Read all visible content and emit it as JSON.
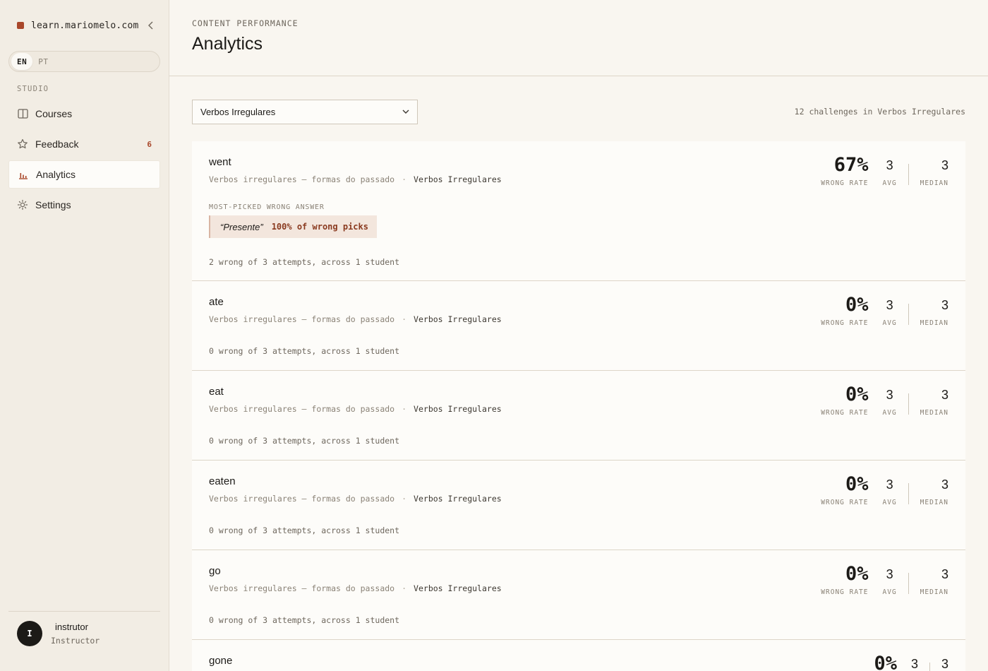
{
  "sidebar": {
    "brand": "learn.mariomelo.com",
    "languages": [
      "EN",
      "PT"
    ],
    "section_label": "STUDIO",
    "nav": [
      {
        "label": "Courses",
        "icon": "book-icon",
        "badge": ""
      },
      {
        "label": "Feedback",
        "icon": "star-icon",
        "badge": "6"
      },
      {
        "label": "Analytics",
        "icon": "bar-chart-icon",
        "badge": ""
      },
      {
        "label": "Settings",
        "icon": "gear-icon",
        "badge": ""
      }
    ],
    "user": {
      "initial": "I",
      "name": "instrutor",
      "role": "Instructor"
    }
  },
  "header": {
    "eyebrow": "CONTENT PERFORMANCE",
    "title": "Analytics"
  },
  "filter": {
    "selected": "Verbos Irregulares",
    "count_text": "12 challenges in Verbos Irregulares"
  },
  "stat_labels": {
    "wrong_rate": "WRONG RATE",
    "avg": "AVG",
    "median": "MEDIAN"
  },
  "challenges": [
    {
      "word": "went",
      "lesson": "Verbos irregulares — formas do passado",
      "separator": "·",
      "course": "Verbos Irregulares",
      "wrong_rate": "67%",
      "avg": "3",
      "median": "3",
      "most_picked_label": "MOST-PICKED WRONG ANSWER",
      "most_picked_answer": "“Presente”",
      "most_picked_pct": "100% of wrong picks",
      "summary": "2 wrong of 3 attempts, across 1 student"
    },
    {
      "word": "ate",
      "lesson": "Verbos irregulares — formas do passado",
      "separator": "·",
      "course": "Verbos Irregulares",
      "wrong_rate": "0%",
      "avg": "3",
      "median": "3",
      "summary": "0 wrong of 3 attempts, across 1 student"
    },
    {
      "word": "eat",
      "lesson": "Verbos irregulares — formas do passado",
      "separator": "·",
      "course": "Verbos Irregulares",
      "wrong_rate": "0%",
      "avg": "3",
      "median": "3",
      "summary": "0 wrong of 3 attempts, across 1 student"
    },
    {
      "word": "eaten",
      "lesson": "Verbos irregulares — formas do passado",
      "separator": "·",
      "course": "Verbos Irregulares",
      "wrong_rate": "0%",
      "avg": "3",
      "median": "3",
      "summary": "0 wrong of 3 attempts, across 1 student"
    },
    {
      "word": "go",
      "lesson": "Verbos irregulares — formas do passado",
      "separator": "·",
      "course": "Verbos Irregulares",
      "wrong_rate": "0%",
      "avg": "3",
      "median": "3",
      "summary": "0 wrong of 3 attempts, across 1 student"
    },
    {
      "word": "gone",
      "lesson": "",
      "separator": "",
      "course": "",
      "wrong_rate": "0%",
      "avg": "3",
      "median": "3",
      "summary": ""
    }
  ]
}
